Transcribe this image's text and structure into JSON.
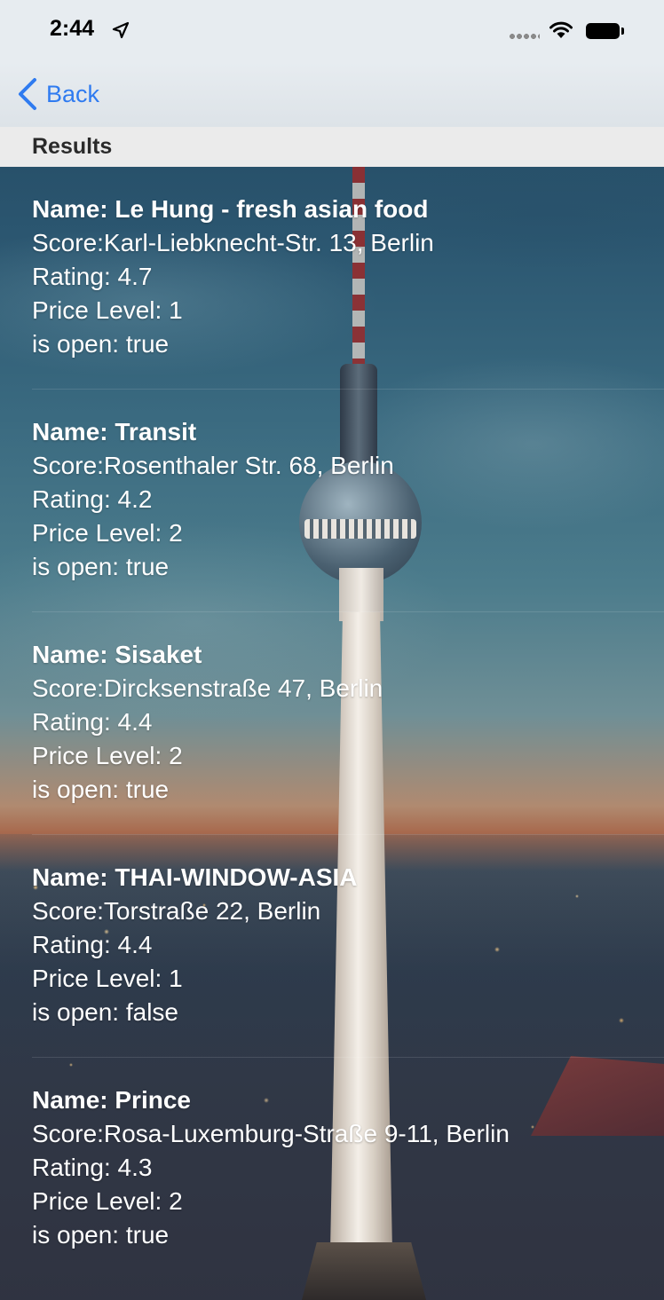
{
  "status_bar": {
    "time": "2:44"
  },
  "nav": {
    "back_label": "Back"
  },
  "section": {
    "title": "Results"
  },
  "results": [
    {
      "name": "Name: Le Hung - fresh asian food",
      "score": "Score:Karl-Liebknecht-Str. 13, Berlin",
      "rating": "Rating: 4.7",
      "price": "Price Level: 1",
      "open": "is open: true"
    },
    {
      "name": "Name: Transit",
      "score": "Score:Rosenthaler Str. 68, Berlin",
      "rating": "Rating: 4.2",
      "price": "Price Level: 2",
      "open": "is open: true"
    },
    {
      "name": "Name: Sisaket",
      "score": "Score:Dircksenstraße 47, Berlin",
      "rating": "Rating: 4.4",
      "price": "Price Level: 2",
      "open": "is open: true"
    },
    {
      "name": "Name: THAI-WINDOW-ASIA",
      "score": "Score:Torstraße 22, Berlin",
      "rating": "Rating: 4.4",
      "price": "Price Level: 1",
      "open": "is open: false"
    },
    {
      "name": "Name: Prince",
      "score": "Score:Rosa-Luxemburg-Straße 9-11, Berlin",
      "rating": "Rating: 4.3",
      "price": "Price Level: 2",
      "open": "is open: true"
    }
  ],
  "colors": {
    "accent": "#2f7bf0",
    "header_bg": "#ebebeb",
    "text_on_image": "#ffffff"
  },
  "icons": {
    "back": "chevron-left-icon",
    "location": "location-arrow-icon",
    "wifi": "wifi-icon",
    "battery": "battery-icon"
  }
}
